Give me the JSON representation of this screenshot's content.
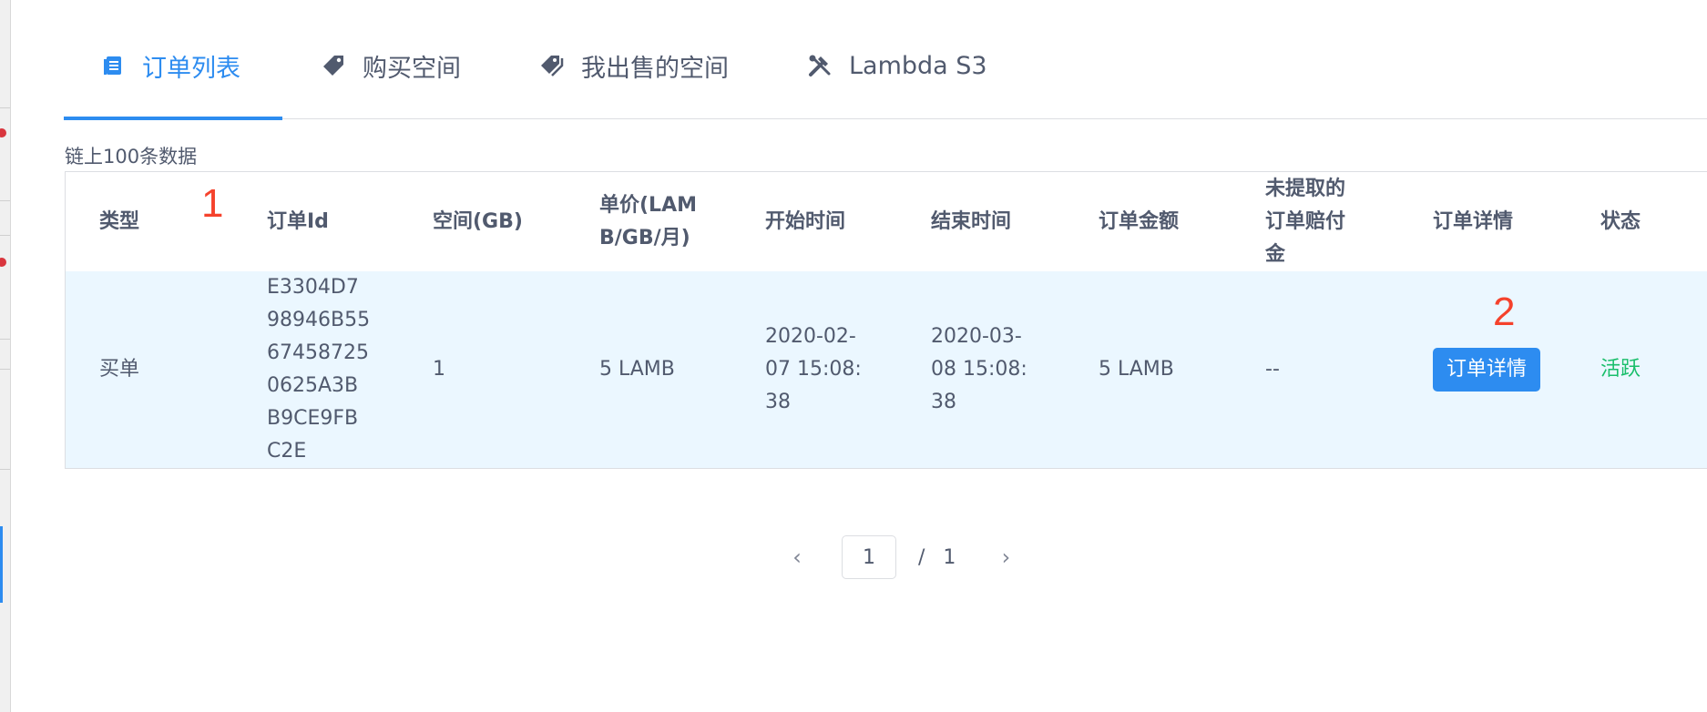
{
  "tabs": [
    {
      "label": "订单列表",
      "icon": "document-icon",
      "active": true
    },
    {
      "label": "购买空间",
      "icon": "tag-icon"
    },
    {
      "label": "我出售的空间",
      "icon": "tags-icon"
    },
    {
      "label": "Lambda S3",
      "icon": "tools-icon"
    }
  ],
  "summary": "链上100条数据",
  "table": {
    "headers": {
      "type": "类型",
      "order_id": [
        "订单Id"
      ],
      "space": "空间(GB)",
      "price": [
        "单价(LAM",
        "B/GB/月)"
      ],
      "start": "开始时间",
      "end": "结束时间",
      "amount": "订单金额",
      "unclaimed": [
        "未提取的",
        "订单赔付",
        "金"
      ],
      "detail": "订单详情",
      "status": "状态"
    },
    "row": {
      "type": "买单",
      "order_id": [
        "E3304D7",
        "98946B55",
        "67458725",
        "0625A3B",
        "B9CE9FB",
        "C2E"
      ],
      "space": "1",
      "price": "5 LAMB",
      "start": [
        "2020-02-",
        "07 15:08:",
        "38"
      ],
      "end": [
        "2020-03-",
        "08 15:08:",
        "38"
      ],
      "amount": "5 LAMB",
      "unclaimed": "--",
      "detail_button": "订单详情",
      "status": "活跃"
    }
  },
  "annotations": {
    "marker1": "1",
    "marker2": "2"
  },
  "pagination": {
    "prev": "‹",
    "current": "1",
    "slash": "/",
    "total": "1",
    "next": "›"
  },
  "colors": {
    "accent": "#2d8cf0",
    "row_highlight": "#ebf7ff",
    "status_active": "#19be6b",
    "annotation": "#f5422c"
  }
}
